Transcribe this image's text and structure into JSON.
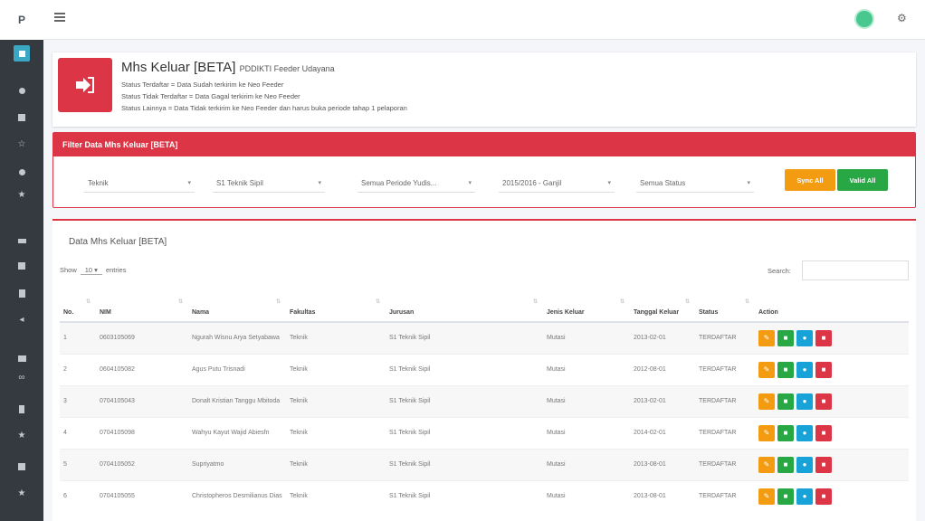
{
  "brand": "P",
  "colors": {
    "danger": "#dc3545",
    "warning": "#f39c12",
    "success": "#28a745",
    "info": "#17a2d8",
    "sidebar": "#343a40"
  },
  "sidebar_icons": [
    "dashboard-icon",
    "home-icon",
    "table-icon",
    "star-icon",
    "plugin-icon",
    "star-icon",
    "chat-icon",
    "folder-icon",
    "document-icon",
    "send-icon",
    "chart-icon",
    "link-icon",
    "bookmark-icon",
    "star-icon",
    "folder-icon",
    "star-icon"
  ],
  "info": {
    "title": "Mhs Keluar [BETA]",
    "subtitle": "PDDIKTI Feeder Udayana",
    "lines": [
      "Status Terdaftar = Data Sudah terkirim ke Neo Feeder",
      "Status Tidak Terdaftar = Data Gagal terkirim ke Neo Feeder",
      "Status Lainnya = Data Tidak terkirim ke Neo Feeder dan harus buka periode tahap 1 pelaporan"
    ]
  },
  "filter": {
    "header": "Filter Data Mhs Keluar [BETA]",
    "fakultas": "Teknik",
    "prodi": "S1 Teknik Sipil",
    "periode": "Semua Periode Yudis...",
    "semester": "2015/2016 - Ganjil",
    "status": "Semua Status",
    "sync_all": "Sync All",
    "valid_all": "Valid All"
  },
  "card": {
    "title": "Data Mhs Keluar [BETA]",
    "show": "Show",
    "entries_value": "10",
    "entries": "entries",
    "search": "Search:"
  },
  "table": {
    "headers": [
      "No.",
      "NIM",
      "Nama",
      "Fakultas",
      "Jurusan",
      "Jenis Keluar",
      "Tanggal Keluar",
      "Status",
      "Action"
    ],
    "rows": [
      {
        "no": "1",
        "nim": "0603105069",
        "nama": "Ngurah Wisnu Arya Setyabawa",
        "fakultas": "Teknik",
        "jurusan": "S1 Teknik Sipil",
        "jenis": "Mutasi",
        "tanggal": "2013-02-01",
        "status": "TERDAFTAR"
      },
      {
        "no": "2",
        "nim": "0604105082",
        "nama": "Agus Putu Trisnadi",
        "fakultas": "Teknik",
        "jurusan": "S1 Teknik Sipil",
        "jenis": "Mutasi",
        "tanggal": "2012-08-01",
        "status": "TERDAFTAR"
      },
      {
        "no": "3",
        "nim": "0704105043",
        "nama": "Donalt Kristian Tanggu Mbitoda",
        "fakultas": "Teknik",
        "jurusan": "S1 Teknik Sipil",
        "jenis": "Mutasi",
        "tanggal": "2013-02-01",
        "status": "TERDAFTAR"
      },
      {
        "no": "4",
        "nim": "0704105098",
        "nama": "Wahyu Kayut Wajid Abiesfn",
        "fakultas": "Teknik",
        "jurusan": "S1 Teknik Sipil",
        "jenis": "Mutasi",
        "tanggal": "2014-02-01",
        "status": "TERDAFTAR"
      },
      {
        "no": "5",
        "nim": "0704105052",
        "nama": "Supriyatmo",
        "fakultas": "Teknik",
        "jurusan": "S1 Teknik Sipil",
        "jenis": "Mutasi",
        "tanggal": "2013-08-01",
        "status": "TERDAFTAR"
      },
      {
        "no": "6",
        "nim": "0704105055",
        "nama": "Christopheros Desmilianus Dias",
        "fakultas": "Teknik",
        "jurusan": "S1 Teknik Sipil",
        "jenis": "Mutasi",
        "tanggal": "2013-08-01",
        "status": "TERDAFTAR"
      }
    ]
  }
}
